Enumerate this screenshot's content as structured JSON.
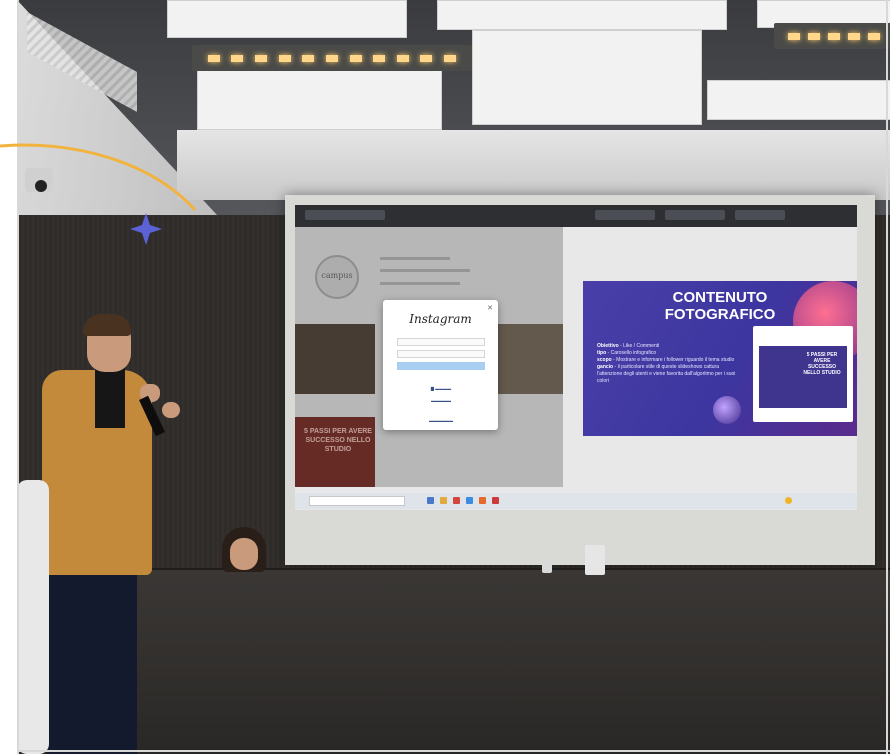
{
  "colors": {
    "accent_arc": "#f2b33d",
    "star": "#5b62d6",
    "slide_bg": "#4a3fa8"
  },
  "browser": {
    "modal": {
      "logo": "Instagram",
      "close_icon": "close-icon",
      "facebook_link_icon": "facebook-icon"
    },
    "profile": {
      "avatar_text": "campus"
    },
    "promo": {
      "text": "5 PASSI PER AVERE SUCCESSO NELLO STUDIO"
    }
  },
  "slide": {
    "title": "CONTENUTO FOTOGRAFICO",
    "lines": [
      {
        "label": "Obiettivo",
        "text": " - Like / Commenti"
      },
      {
        "label": "tipo",
        "text": " - Carosello infografico"
      },
      {
        "label": "scopo",
        "text": " - Mostrare e informare i follower riguardo il tema studio"
      },
      {
        "label": "gancio",
        "text": " - il particolare stile di queste slideshows cattura l'attenzione degli utenti e viene favorita dall'algoritmo per i suoi colori"
      }
    ],
    "card_text": "5 PASSI PER AVERE SUCCESSO NELLO STUDIO"
  },
  "decor": {
    "star_icon": "four-point-star-icon",
    "arc_icon": "curved-line-decoration"
  }
}
